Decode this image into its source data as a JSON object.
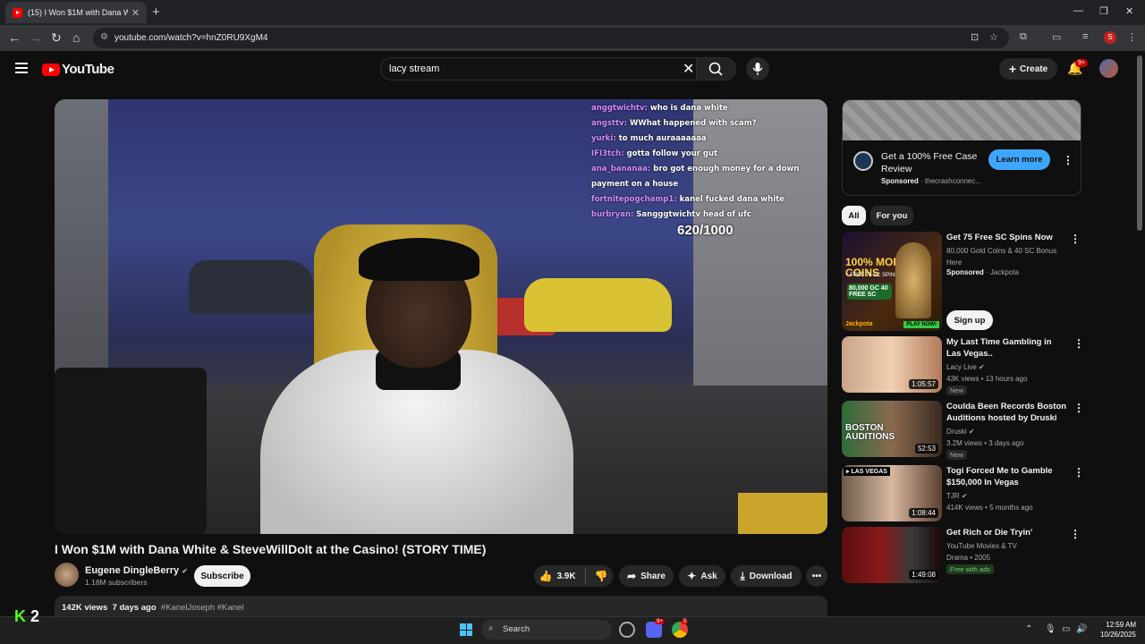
{
  "browser": {
    "tab_title": "(15) I Won $1M with Dana Whi",
    "tab_close": "✕",
    "new_tab": "+",
    "url": "youtube.com/watch?v=hnZ0RU9XgM4",
    "profile_initial": "S"
  },
  "yt": {
    "logo_text": "YouTube",
    "search_query": "lacy stream",
    "create_label": "Create",
    "notif_badge": "9+"
  },
  "video": {
    "chat": [
      {
        "user": "anggtwichtv:",
        "msg": "who is dana white"
      },
      {
        "user": "angsttv:",
        "msg": "WWhat happened with scam?"
      },
      {
        "user": "yurki:",
        "msg": "to much auraaaaaaa"
      },
      {
        "user": "IFI3tch:",
        "msg": "gotta follow your gut"
      },
      {
        "user": "ana_bananaa:",
        "msg": "bro got enough money for a down payment on a house"
      },
      {
        "user": "fortnitepogchamp1:",
        "msg": "kanel fucked dana white"
      },
      {
        "user": "burbryan:",
        "msg": "Sangggtwichtv head of ufc"
      }
    ],
    "counter": "620/1000",
    "title": "I Won $1M with Dana White & SteveWillDoIt at the Casino! (STORY TIME)",
    "channel": "Eugene DingleBerry",
    "verified": "✔",
    "subscribers": "1.18M subscribers",
    "subscribe_label": "Subscribe",
    "likes": "3.9K",
    "share_label": "Share",
    "ask_label": "Ask",
    "download_label": "Download",
    "views": "142K views",
    "age": "7 days ago",
    "tags": "#KanelJoseph #Kanel"
  },
  "sidebar": {
    "ad": {
      "title": "Get a 100% Free Case Review",
      "sponsored": "Sponsored",
      "advertiser": "· thecrashconnec...",
      "cta": "Learn more"
    },
    "chips": [
      "All",
      "For you"
    ],
    "promo": {
      "title": "Get 75 Free SC Spins Now",
      "desc": "80,000 Gold Coins & 40 SC Bonus Here",
      "sponsored": "Sponsored",
      "advertiser": "· Jackpota",
      "cta": "Sign up",
      "thumb_text1": "100% MORE COINS",
      "thumb_text2": "+ FREE 75 SC SPINS",
      "thumb_text3": "80,000 GC 40 FREE SC",
      "thumb_brand": "Jackpota",
      "thumb_play": "PLAY NOW!"
    },
    "videos": [
      {
        "title": "My Last Time Gambling in Las Vegas..",
        "channel": "Lacy Live",
        "meta": "43K views • 13 hours ago",
        "duration": "1:05:57",
        "badge": "New"
      },
      {
        "title": "Coulda Been Records Boston Auditions hosted by Druski",
        "channel": "Druski",
        "meta": "3.2M views • 3 days ago",
        "duration": "52:53",
        "badge": "New",
        "thumb_text": "BOSTON AUDITIONS"
      },
      {
        "title": "Togi Forced Me to Gamble $150,000 In Vegas",
        "channel": "TJR",
        "meta": "414K views • 5 months ago",
        "duration": "1:08:44",
        "thumb_text": "LAS VEGAS"
      },
      {
        "title": "Get Rich or Die Tryin'",
        "channel": "YouTube Movies & TV",
        "meta": "Drama • 2005",
        "duration": "1:49:08",
        "badge": "Free with ads"
      }
    ]
  },
  "taskbar": {
    "search_label": "Search",
    "time": "12:59 AM",
    "date": "10/26/2025",
    "k2_num": "2",
    "discord_badge": "9+",
    "chrome_badge": "5"
  }
}
